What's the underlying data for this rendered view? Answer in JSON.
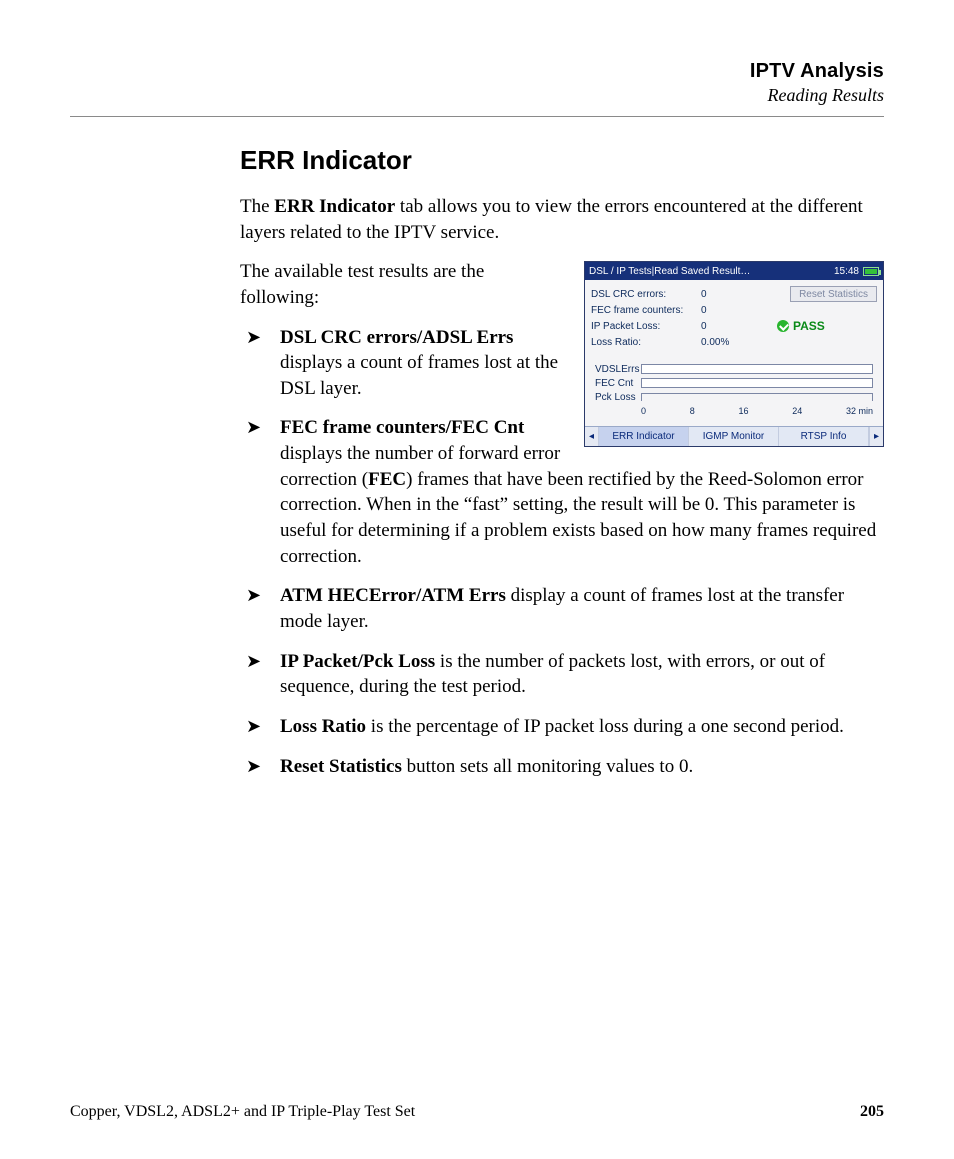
{
  "header": {
    "chapter": "IPTV Analysis",
    "section": "Reading Results"
  },
  "title": "ERR Indicator",
  "intro": {
    "pre": "The ",
    "bold": "ERR Indicator",
    "post": " tab allows you to view the errors encountered at the different layers related to the IPTV service."
  },
  "lead": "The available test results are the following:",
  "bullets": [
    {
      "term": "DSL CRC errors/ADSL Errs",
      "text": " displays a count of frames lost at the DSL layer."
    },
    {
      "term": "FEC frame counters/FEC Cnt",
      "text_pre": " displays the number of forward error correction (",
      "term2": "FEC",
      "text_post": ") frames that have been rectified by the Reed-Solomon error correction. When in the “fast” setting, the result will be 0. This parameter is useful for determining if a problem exists based on how many frames required correction."
    },
    {
      "term": "ATM HECError/ATM Errs",
      "text": " display a count of frames lost at the transfer mode layer."
    },
    {
      "term": "IP Packet/Pck Loss",
      "text": " is the number of packets lost, with errors, or out of sequence, during the test period."
    },
    {
      "term": "Loss Ratio",
      "text": " is the percentage of IP packet loss during a one second period."
    },
    {
      "term": "Reset Statistics",
      "text": " button sets all monitoring values to 0."
    }
  ],
  "footer": {
    "book": "Copper, VDSL2, ADSL2+ and IP Triple-Play Test Set",
    "page": "205"
  },
  "device": {
    "title": "DSL / IP Tests|Read Saved Result…",
    "clock": "15:48",
    "reset_label": "Reset Statistics",
    "pass_label": "PASS",
    "rows": [
      {
        "label": "DSL CRC errors:",
        "value": "0"
      },
      {
        "label": "FEC frame counters:",
        "value": "0"
      },
      {
        "label": "IP Packet Loss:",
        "value": "0"
      },
      {
        "label": "Loss Ratio:",
        "value": "0.00%"
      }
    ],
    "graph_labels": {
      "row1": "VDSLErrs",
      "row2": "FEC Cnt",
      "row3": "Pck Loss"
    },
    "xticks": [
      "0",
      "8",
      "16",
      "24",
      "32 min"
    ],
    "tabs": {
      "left_arrow": "◂",
      "right_arrow": "▸",
      "t1": "ERR Indicator",
      "t2": "IGMP Monitor",
      "t3": "RTSP Info"
    }
  }
}
